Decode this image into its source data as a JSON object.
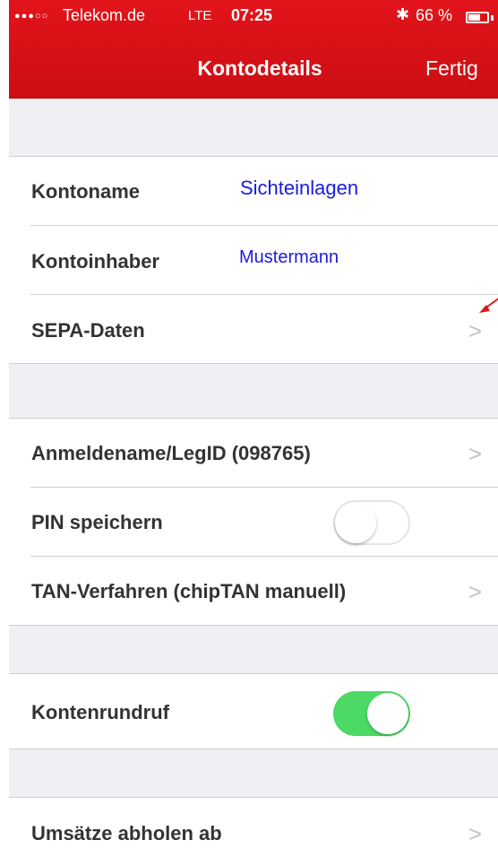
{
  "status_bar": {
    "signal_dots": "●●●○○",
    "carrier": "Telekom.de",
    "network": "LTE",
    "time": "07:25",
    "bluetooth_icon": "bluetooth-icon",
    "battery_percent": "66 %",
    "battery_level": 0.66
  },
  "nav": {
    "title": "Kontodetails",
    "done_label": "Fertig"
  },
  "account": {
    "name_label": "Kontoname",
    "name_value": "Sichteinlagen",
    "owner_label": "Kontoinhaber",
    "owner_value": "Mustermann",
    "sepa_label": "SEPA-Daten"
  },
  "login": {
    "login_label": "Anmeldename/LegID (098765)",
    "pin_label": "PIN speichern",
    "pin_saved": false,
    "tan_label": "TAN-Verfahren (chipTAN manuell)"
  },
  "broadcast": {
    "label": "Kontenrundruf",
    "enabled": true
  },
  "transactions": {
    "label": "Umsätze abholen ab"
  },
  "colors": {
    "header_red": "#e2141b",
    "value_blue": "#1a1adf",
    "toggle_green": "#4cd964",
    "annotation_arrow": "#e0161c"
  }
}
